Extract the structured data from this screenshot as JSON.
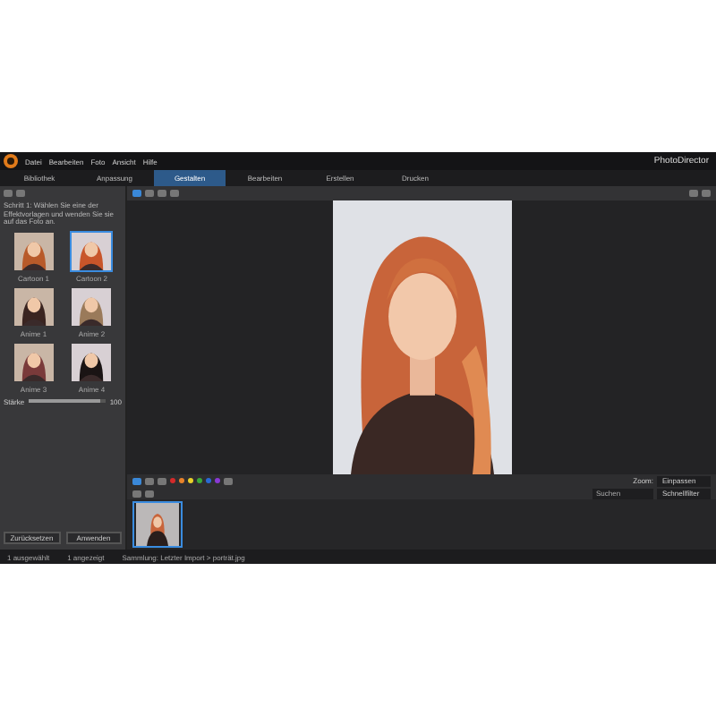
{
  "window": {
    "title": "PhotoDirector"
  },
  "menu": [
    "Datei",
    "Bearbeiten",
    "Foto",
    "Ansicht",
    "Hilfe"
  ],
  "tabs": [
    {
      "label": "Bibliothek",
      "selected": false
    },
    {
      "label": "Anpassung",
      "selected": false
    },
    {
      "label": "Gestalten",
      "selected": true
    },
    {
      "label": "Bearbeiten",
      "selected": false
    },
    {
      "label": "Erstellen",
      "selected": false
    },
    {
      "label": "Drucken",
      "selected": false
    }
  ],
  "panel": {
    "instruction": "Schritt 1: Wählen Sie eine der Effektvorlagen und wenden Sie sie auf das Foto an.",
    "presets": [
      {
        "label": "Cartoon 1",
        "selected": false
      },
      {
        "label": "Cartoon 2",
        "selected": true
      },
      {
        "label": "Anime 1",
        "selected": false
      },
      {
        "label": "Anime 2",
        "selected": false
      },
      {
        "label": "Anime 3",
        "selected": false
      },
      {
        "label": "Anime 4",
        "selected": false
      }
    ],
    "strength": {
      "label": "Stärke",
      "level": 0.93,
      "reading": "100"
    },
    "buttons": [
      "Zurücksetzen",
      "Anwenden"
    ]
  },
  "color_labels": [
    {
      "color": "#d42a2a"
    },
    {
      "color": "#e8832a"
    },
    {
      "color": "#e8d02a"
    },
    {
      "color": "#3aa83a"
    },
    {
      "color": "#2a6ad4"
    },
    {
      "color": "#8a3ad4"
    }
  ],
  "zoom": {
    "label": "Zoom:",
    "value": "Einpassen"
  },
  "search": {
    "placeholder": "Suchen"
  },
  "filter": {
    "value": "Schnellfilter"
  },
  "filmstrip": [
    {
      "selected": true
    }
  ],
  "status_bar": [
    "1 ausgewählt",
    "1 angezeigt",
    "Sammlung: Letzter Import > porträt.jpg"
  ]
}
